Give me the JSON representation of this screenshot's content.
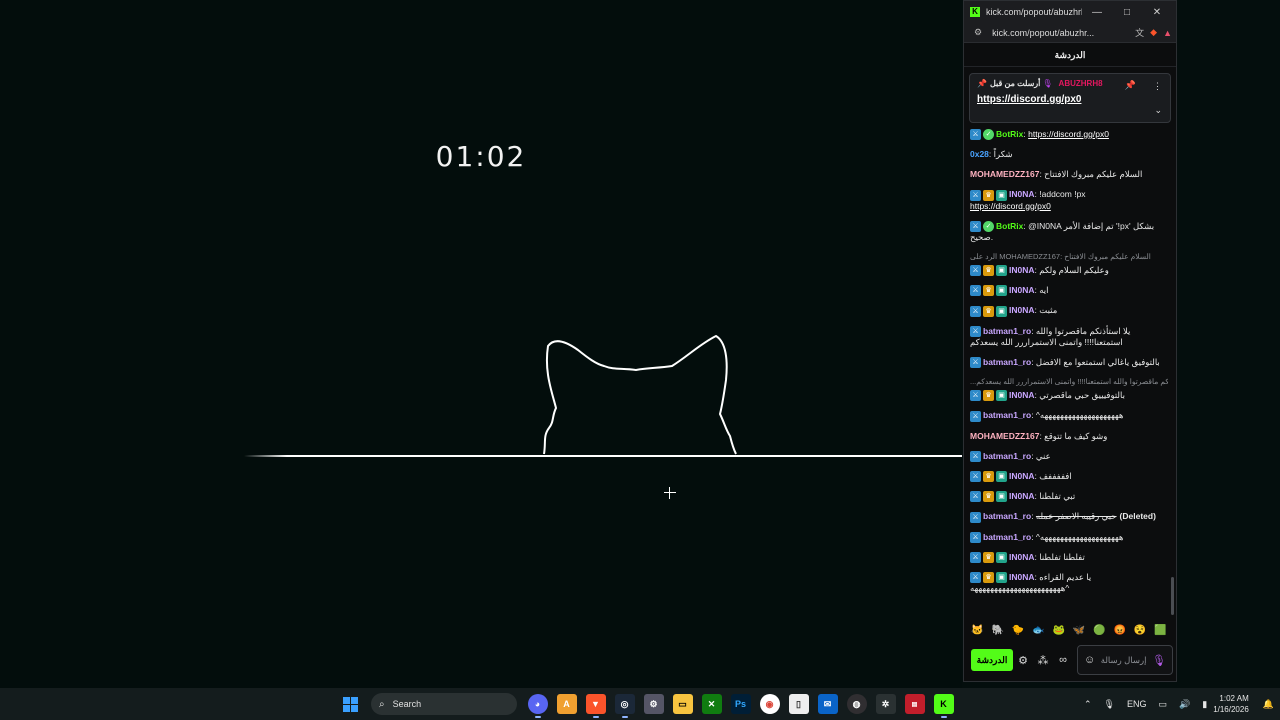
{
  "stream": {
    "timer": "01:02"
  },
  "window": {
    "title": "kick.com/popout/abuzhrh8/...",
    "url": "kick.com/popout/abuzhr...",
    "minimize": "—",
    "maximize": "□",
    "close": "✕"
  },
  "chat": {
    "header": "الدردشة",
    "pinned": {
      "by_label": "أرسلت من قبل",
      "user": "ABUZHRH8",
      "link": "https://discord.gg/px0"
    },
    "messages": [
      {
        "user": "BotRix",
        "color": "#53fc18",
        "badges": [
          "mod",
          "verify"
        ],
        "text": "",
        "link": "https://discord.gg/px0"
      },
      {
        "user": "0x28",
        "color": "#4aa3ff",
        "badges": [],
        "text": "شكراً"
      },
      {
        "user": "MOHAMEDZZ167",
        "color": "#ffb3c1",
        "badges": [],
        "text": "السلام عليكم مبروك الافتتاح"
      },
      {
        "user": "IN0NA",
        "color": "#c9a7ff",
        "badges": [
          "mod",
          "vip",
          "sub"
        ],
        "text": "!addcom !px",
        "link": "https://discord.gg/px0"
      },
      {
        "user": "BotRix",
        "color": "#53fc18",
        "badges": [
          "mod",
          "verify"
        ],
        "text": "@IN0NA تم إضافة الأمر '!px' بشكل صحيح."
      },
      {
        "reply": "الرد على MOHAMEDZZ167: السلام عليكم مبروك الافتتاح",
        "user": "IN0NA",
        "color": "#c9a7ff",
        "badges": [
          "mod",
          "vip",
          "sub"
        ],
        "text": "وعليكم السلام ولكم"
      },
      {
        "user": "IN0NA",
        "color": "#c9a7ff",
        "badges": [
          "mod",
          "vip",
          "sub"
        ],
        "text": "ايه"
      },
      {
        "user": "IN0NA",
        "color": "#c9a7ff",
        "badges": [
          "mod",
          "vip",
          "sub"
        ],
        "text": "مثبت"
      },
      {
        "user": "batman1_ro",
        "color": "#c9a7ff",
        "badges": [
          "mod"
        ],
        "text": "يلا استأذنكم ماقصرتوا والله استمتعنا!!!! واتمنى الاستمراررر الله يسعدكم"
      },
      {
        "user": "batman1_ro",
        "color": "#c9a7ff",
        "badges": [
          "mod"
        ],
        "text": "بالتوفيق ياغالي استمتعوا مع الافضل"
      },
      {
        "reply": "...نكم ماقصرتوا والله استمتعنا!!!! واتمنى الاستمراررر الله يسعدكم",
        "user": "IN0NA",
        "color": "#c9a7ff",
        "badges": [
          "mod",
          "vip",
          "sub"
        ],
        "text": "بالتوفيييق حبي ماقصرتي"
      },
      {
        "user": "batman1_ro",
        "color": "#c9a7ff",
        "badges": [
          "mod"
        ],
        "text": "^ههههههههههههههههههههه"
      },
      {
        "user": "MOHAMEDZZ167",
        "color": "#ffb3c1",
        "badges": [],
        "text": "وشو كيف ما تتوقع"
      },
      {
        "user": "batman1_ro",
        "color": "#c9a7ff",
        "badges": [
          "mod"
        ],
        "text": "عني"
      },
      {
        "user": "IN0NA",
        "color": "#c9a7ff",
        "badges": [
          "mod",
          "vip",
          "sub"
        ],
        "text": "افففففف"
      },
      {
        "user": "IN0NA",
        "color": "#c9a7ff",
        "badges": [
          "mod",
          "vip",
          "sub"
        ],
        "text": "تبي تفلطنا"
      },
      {
        "user": "batman1_ro",
        "color": "#c9a7ff",
        "badges": [
          "mod"
        ],
        "text": "حبي رقيبه الاصفر عمله",
        "deleted": true,
        "deleted_label": "(Deleted)"
      },
      {
        "user": "batman1_ro",
        "color": "#c9a7ff",
        "badges": [
          "mod"
        ],
        "text": "^ههههههههههههههههههههه"
      },
      {
        "user": "IN0NA",
        "color": "#c9a7ff",
        "badges": [
          "mod",
          "vip",
          "sub"
        ],
        "text": "تفلطنا تفلطنا"
      },
      {
        "user": "IN0NA",
        "color": "#c9a7ff",
        "badges": [
          "mod",
          "vip",
          "sub"
        ],
        "text": "يا عديم القراءه ^هههههههههههههههههههههههه"
      }
    ],
    "emotes": [
      "🐱",
      "🐘",
      "🐤",
      "🐟",
      "🐸",
      "🦋",
      "🟢",
      "😡",
      "😵",
      "🟩"
    ],
    "send_label": "الدردشة",
    "input_placeholder": "إرسال رسالة"
  },
  "taskbar": {
    "search_label": "Search",
    "apps": [
      "discord-icon",
      "brave-a-icon",
      "brave-icon",
      "steam-icon",
      "settings-icon",
      "folder-icon",
      "xbox-icon",
      "photoshop-icon",
      "chrome-icon",
      "file-icon",
      "mail-icon",
      "obs-icon",
      "gear-icon",
      "news-icon",
      "kick-icon"
    ],
    "ps_label": "Ps",
    "lang": "ENG",
    "time": "1:02 AM",
    "date": "1/16/2026"
  }
}
